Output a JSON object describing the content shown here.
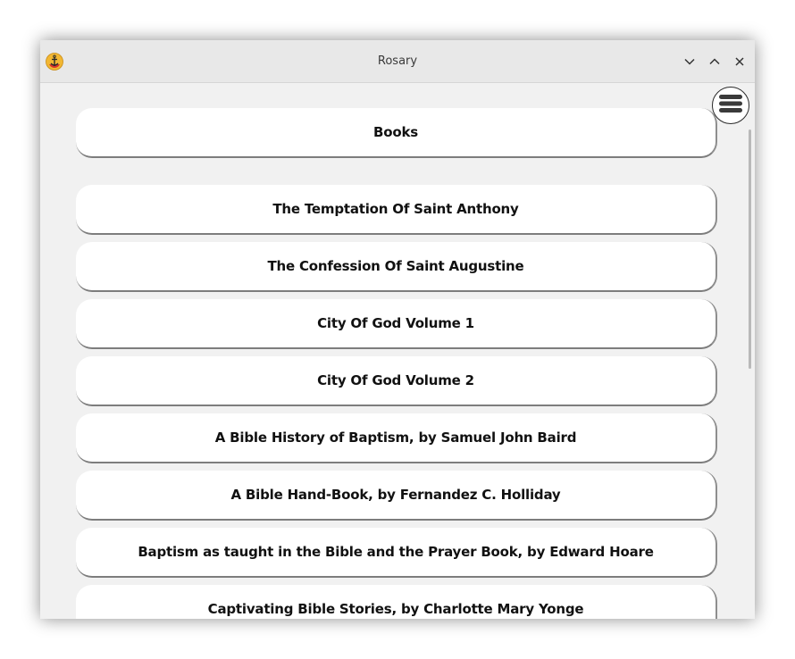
{
  "window": {
    "title": "Rosary",
    "app_icon": "anchor-icon",
    "controls": [
      "minimize-icon",
      "maximize-icon",
      "close-icon"
    ]
  },
  "header_button": {
    "label": "Books"
  },
  "books": [
    {
      "label": "The Temptation Of Saint Anthony"
    },
    {
      "label": "The Confession Of Saint Augustine"
    },
    {
      "label": "City Of God Volume 1"
    },
    {
      "label": "City Of God Volume 2"
    },
    {
      "label": "A Bible History of Baptism, by Samuel John Baird"
    },
    {
      "label": "A Bible Hand-Book, by Fernandez C. Holliday"
    },
    {
      "label": "Baptism as taught in the Bible and the Prayer Book, by Edward Hoare"
    },
    {
      "label": "Captivating Bible Stories, by Charlotte Mary Yonge"
    }
  ],
  "menu_button": {
    "icon": "hamburger-menu-icon"
  }
}
